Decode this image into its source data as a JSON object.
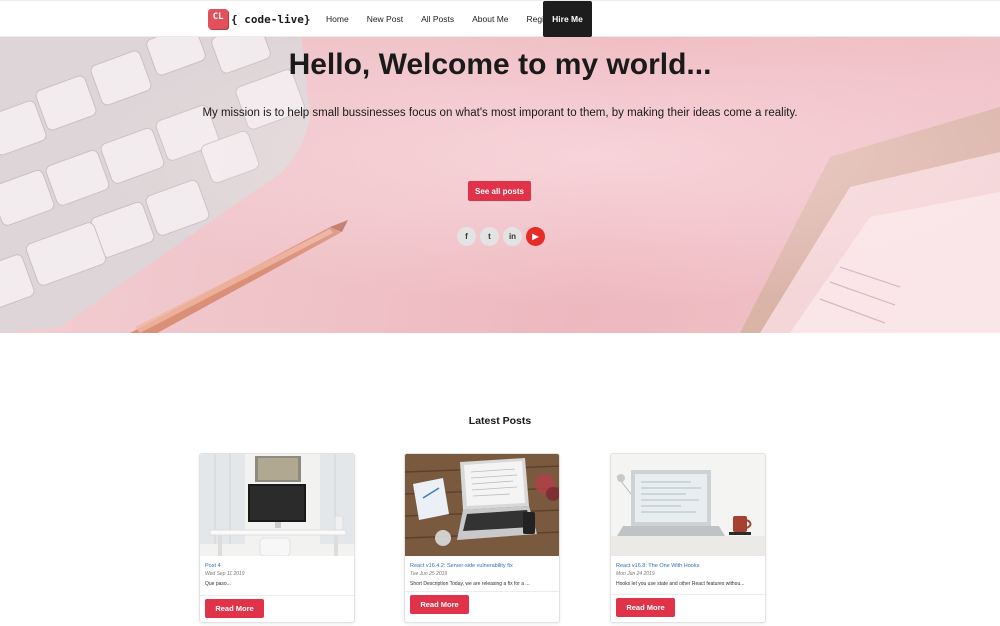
{
  "nav": {
    "logo_badge": "CL",
    "brand": "{ code-live}",
    "links": [
      "Home",
      "New Post",
      "All Posts",
      "About Me",
      "Register"
    ],
    "hire": "Hire Me"
  },
  "hero": {
    "title": "Hello, Welcome to my world...",
    "subtitle": "My mission is to help small bussinesses focus on what's most imporant to them, by making their ideas come a reality.",
    "button": "See all posts",
    "socials": [
      {
        "icon": "facebook-icon",
        "glyph": "f"
      },
      {
        "icon": "twitter-icon",
        "glyph": "t"
      },
      {
        "icon": "linkedin-icon",
        "glyph": "in"
      },
      {
        "icon": "youtube-icon",
        "glyph": "▶"
      }
    ]
  },
  "latest": {
    "title": "Latest Posts",
    "posts": [
      {
        "title": "Post 4",
        "date": "Wed Sep 11 2019",
        "excerpt": "Que paso...",
        "button": "Read More"
      },
      {
        "title": "React v16.4.2: Server-side vulnerability fix",
        "date": "Tue Jun 25 2019",
        "excerpt": "Short Description Today, we are releasing a fix for a ...",
        "button": "Read More"
      },
      {
        "title": "React v16.8: The One With Hooks",
        "date": "Mon Jun 24 2019",
        "excerpt": "Hooks let you use state and other React features withou...",
        "button": "Read More"
      }
    ]
  },
  "colors": {
    "accent": "#e0334a",
    "hire_bg": "#1d1d1d",
    "link": "#2f6fbf"
  }
}
